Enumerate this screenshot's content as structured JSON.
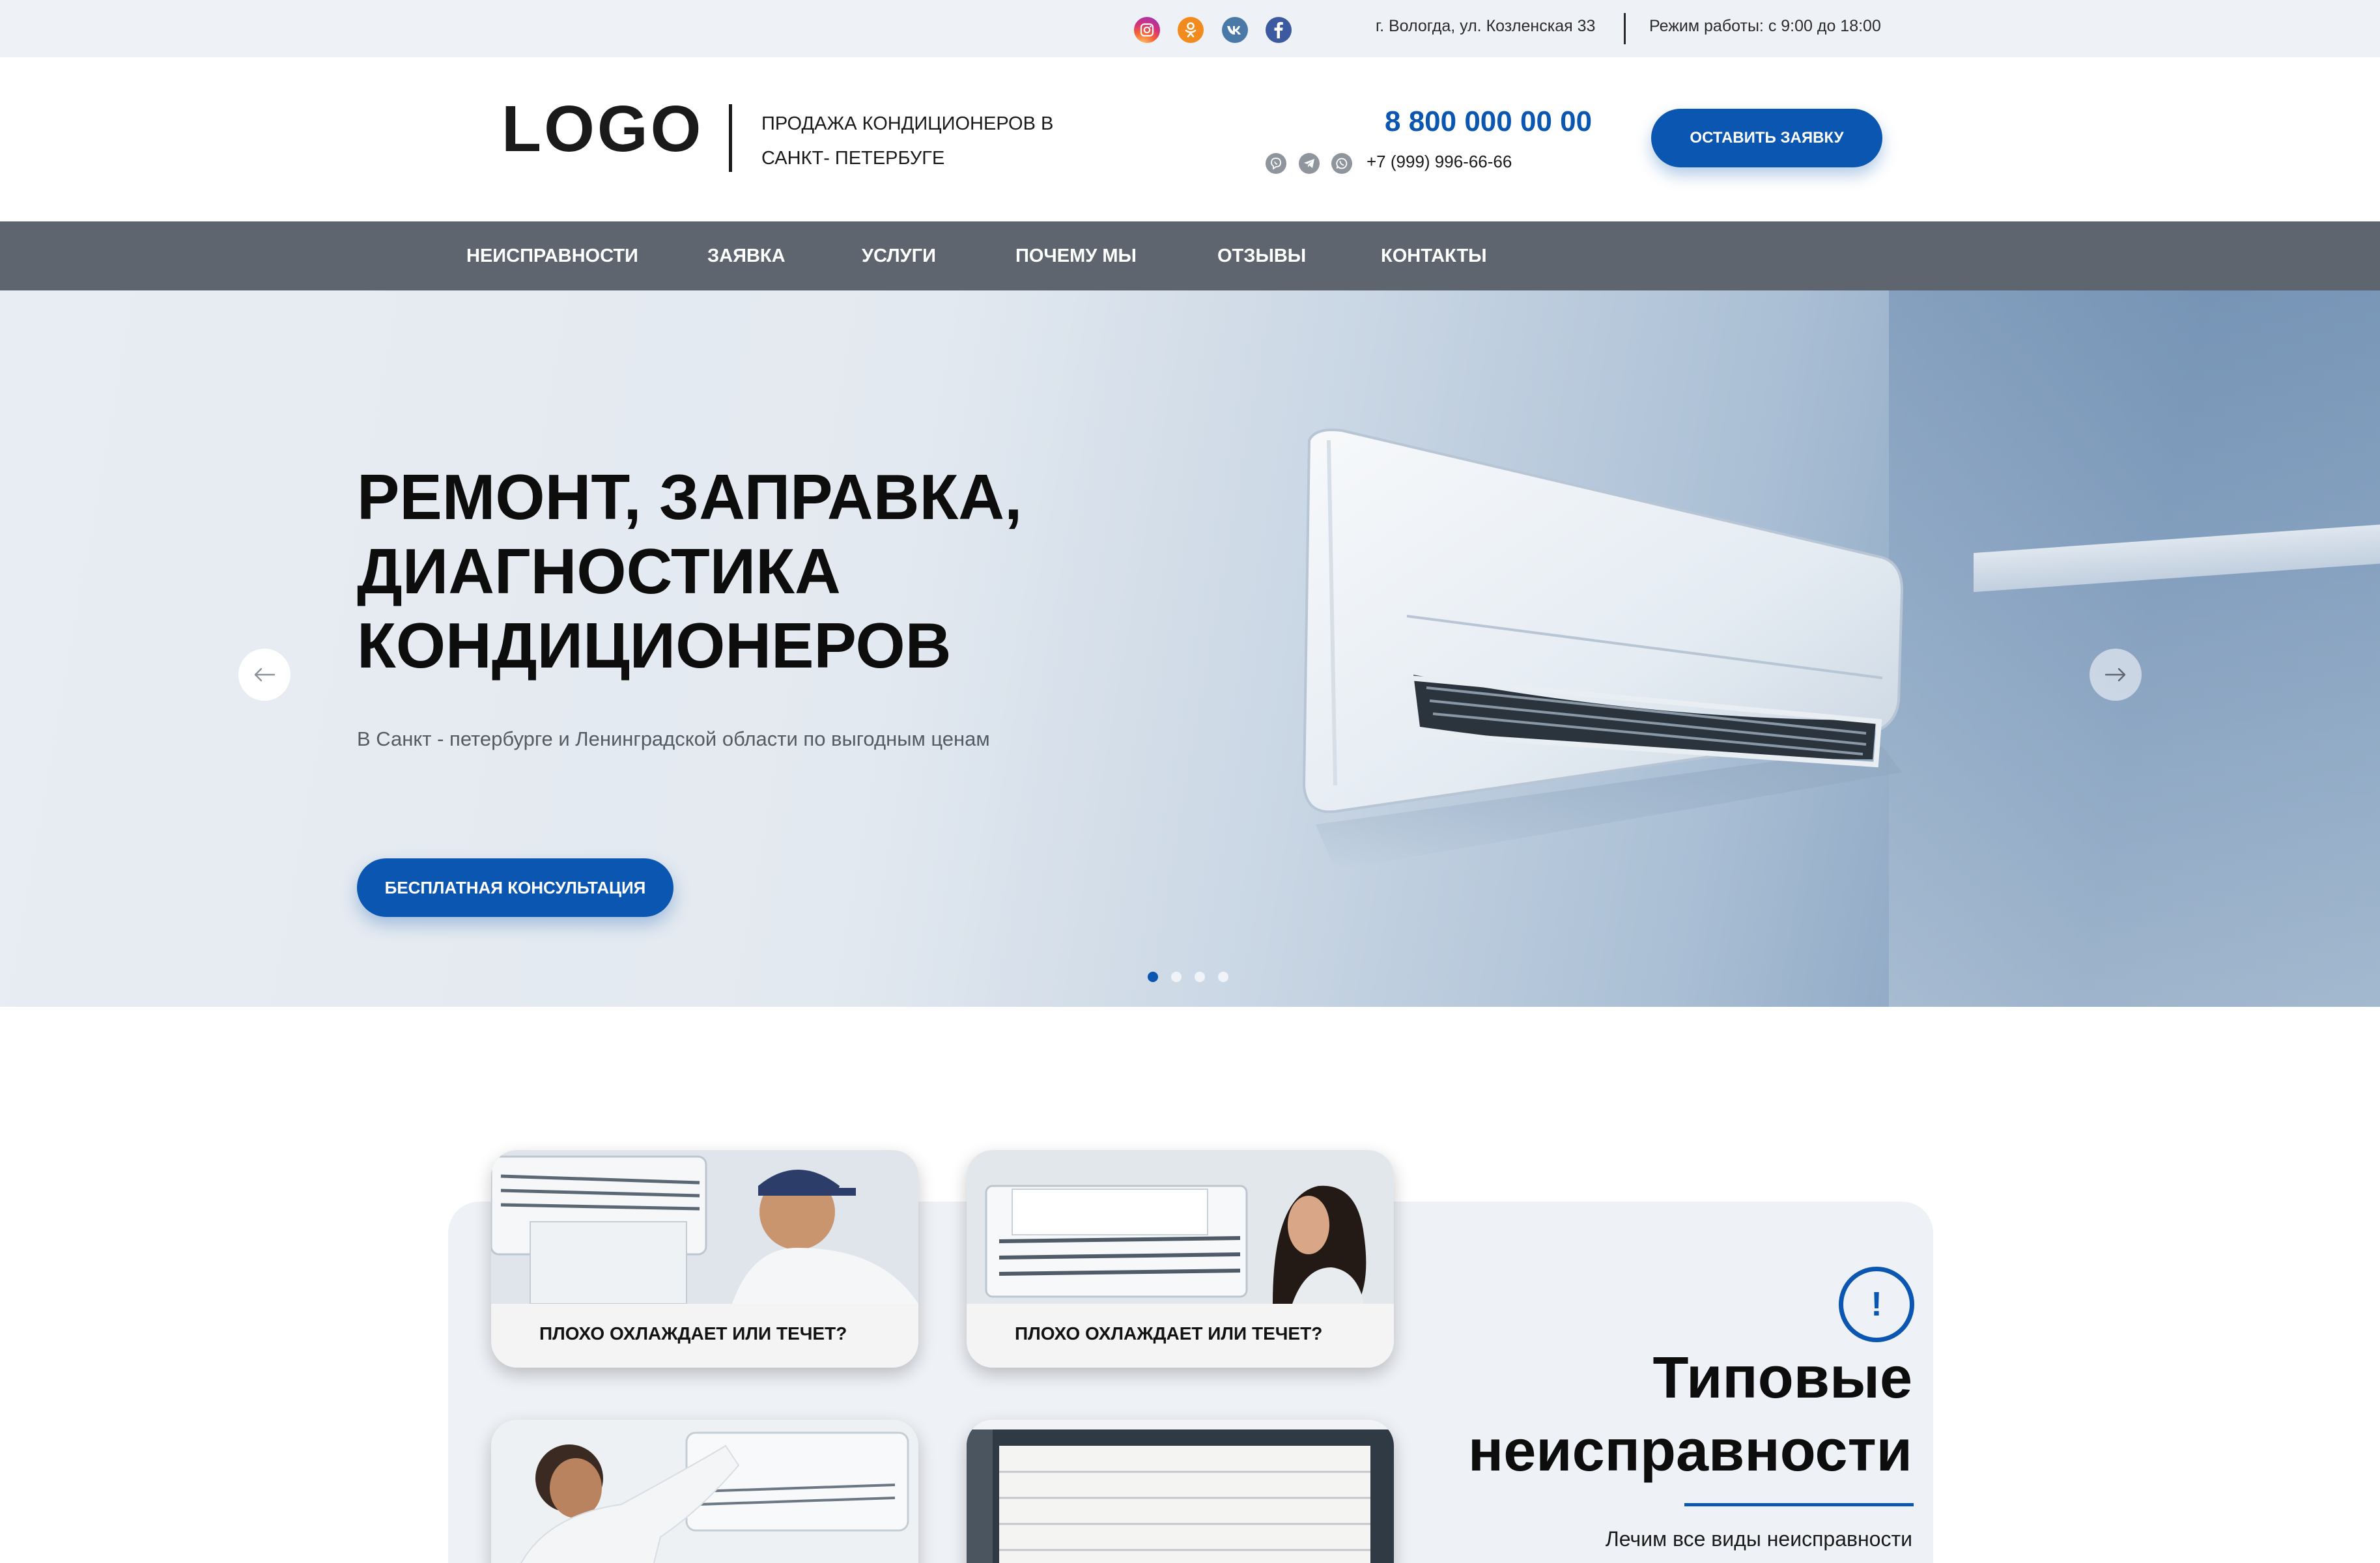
{
  "topbar": {
    "social": [
      "instagram-icon",
      "odnoklassniki-icon",
      "vk-icon",
      "facebook-icon"
    ],
    "address": "г. Вологда, ул. Козленская 33",
    "hours": "Режим работы: с 9:00 до 18:00"
  },
  "header": {
    "logo": "LOGO",
    "tagline_line1": "ПРОДАЖА КОНДИЦИОНЕРОВ В",
    "tagline_line2": "САНКТ- ПЕТЕРБУГЕ",
    "phone_main": "8 800 000 00 00",
    "phone_sub": "+7 (999) 996-66-66",
    "messengers": [
      "viber-icon",
      "telegram-icon",
      "whatsapp-icon"
    ],
    "cta_label": "ОСТАВИТЬ ЗАЯВКУ"
  },
  "nav": {
    "items": [
      {
        "label": "НЕИСПРАВНОСТИ"
      },
      {
        "label": "ЗАЯВКА"
      },
      {
        "label": "УСЛУГИ"
      },
      {
        "label": "ПОЧЕМУ МЫ"
      },
      {
        "label": "ОТЗЫВЫ"
      },
      {
        "label": "КОНТАКТЫ"
      }
    ]
  },
  "hero": {
    "title_line1": "РЕМОНТ, ЗАПРАВКА,",
    "title_line2": "ДИАГНОСТИКА",
    "title_line3": "КОНДИЦИОНЕРОВ",
    "subtitle": "В Санкт - петербурге и Ленинградской области по выгодным ценам",
    "cta_label": "БЕСПЛАТНАЯ КОНСУЛЬТАЦИЯ",
    "slides_total": 4,
    "active_slide": 1
  },
  "problems": {
    "title_line1": "Типовые",
    "title_line2": "неисправности",
    "subtitle": "Лечим все виды неисправности",
    "icon": "exclamation-icon",
    "cards": [
      {
        "label": "ПЛОХО ОХЛАЖДАЕТ ИЛИ ТЕЧЕТ?"
      },
      {
        "label": "ПЛОХО ОХЛАЖДАЕТ ИЛИ ТЕЧЕТ?"
      }
    ]
  },
  "colors": {
    "accent": "#0a56b0",
    "nav_bg": "#5e656e",
    "topbar_bg": "#eef1f6"
  }
}
